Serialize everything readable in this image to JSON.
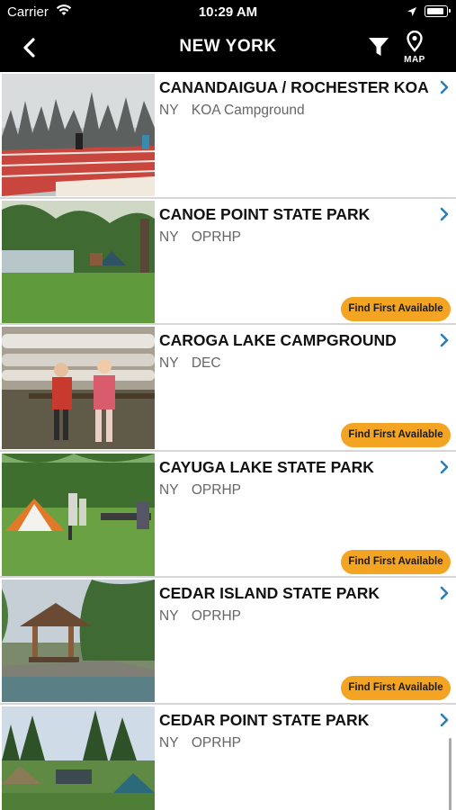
{
  "status_bar": {
    "carrier": "Carrier",
    "time": "10:29 AM"
  },
  "nav": {
    "title": "NEW YORK",
    "map_label": "MAP",
    "back_icon": "chevron-left-icon",
    "filter_icon": "funnel-icon",
    "map_icon": "map-pin-icon"
  },
  "colors": {
    "header_bg": "#000000",
    "button_bg": "#f3a423",
    "chevron": "#2b7fb8",
    "meta_text": "#666666"
  },
  "campgrounds": [
    {
      "name": "CANANDAIGUA / ROCHESTER KOA",
      "state": "NY",
      "agency": "KOA Campground",
      "button": ""
    },
    {
      "name": "CANOE POINT STATE PARK",
      "state": "NY",
      "agency": "OPRHP",
      "button": "Find First Available"
    },
    {
      "name": "CAROGA LAKE CAMPGROUND",
      "state": "NY",
      "agency": "DEC",
      "button": "Find First Available"
    },
    {
      "name": "CAYUGA LAKE STATE PARK",
      "state": "NY",
      "agency": "OPRHP",
      "button": "Find First Available"
    },
    {
      "name": "CEDAR ISLAND STATE PARK",
      "state": "NY",
      "agency": "OPRHP",
      "button": "Find First Available"
    },
    {
      "name": "CEDAR POINT STATE PARK",
      "state": "NY",
      "agency": "OPRHP",
      "button": ""
    }
  ]
}
